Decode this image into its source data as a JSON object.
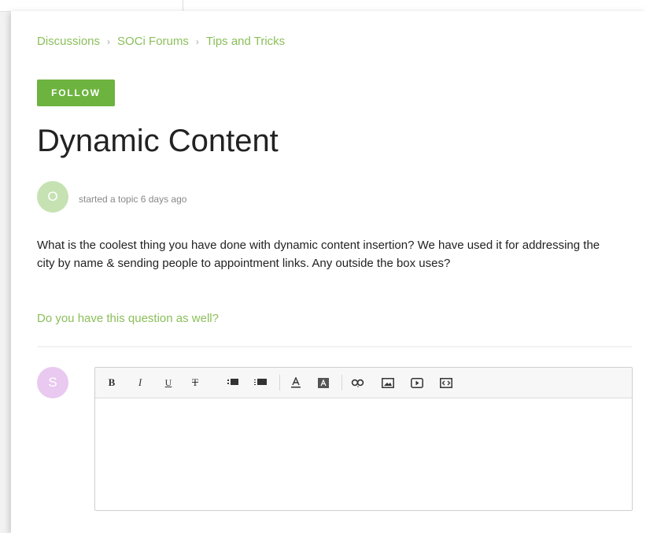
{
  "breadcrumb": {
    "items": [
      "Discussions",
      "SOCi Forums",
      "Tips and Tricks"
    ],
    "separator": "›"
  },
  "follow_button": {
    "label": "FOLLOW"
  },
  "topic": {
    "title": "Dynamic Content",
    "author_initial": "O",
    "meta": "started a topic 6 days ago",
    "body": "What is the coolest thing you have done with dynamic content insertion? We have used it for addressing the city by name & sending people to appointment links. Any outside the box uses?"
  },
  "question_link": "Do you have this question as well?",
  "reply": {
    "user_initial": "S",
    "toolbar_icons": [
      "bold-icon",
      "italic-icon",
      "underline-icon",
      "strikethrough-icon",
      "bulleted-list-icon",
      "numbered-list-icon",
      "text-color-icon",
      "background-color-icon",
      "link-icon",
      "image-icon",
      "video-icon",
      "code-icon"
    ],
    "toolbar_glyphs": {
      "bold": "B",
      "italic": "I",
      "underline": "U",
      "strike": "T"
    }
  },
  "colors": {
    "accent_green": "#6db33f",
    "link_green": "#8bbf5a",
    "avatar_o_bg": "#c6e2b3",
    "avatar_s_bg": "#e9c9f0"
  }
}
